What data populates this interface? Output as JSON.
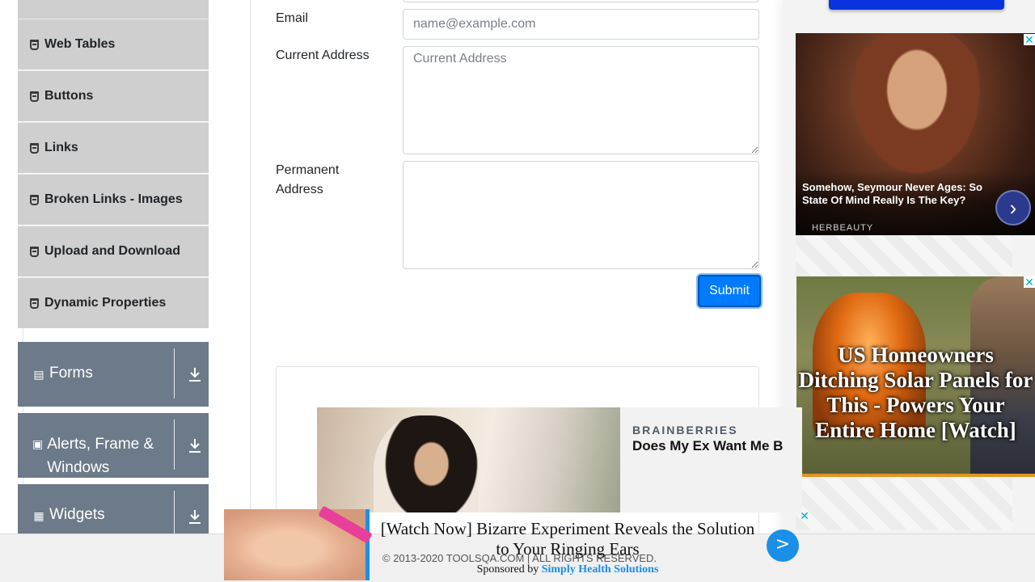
{
  "sidebar": {
    "elements_items": [
      {
        "label": ""
      },
      {
        "label": "Web Tables"
      },
      {
        "label": "Buttons"
      },
      {
        "label": "Links"
      },
      {
        "label": "Broken Links - Images"
      },
      {
        "label": "Upload and Download"
      },
      {
        "label": "Dynamic Properties"
      }
    ],
    "groups": [
      {
        "label": "Forms",
        "icon": "document-icon"
      },
      {
        "label": "Alerts, Frame & Windows",
        "icon": "window-icon"
      },
      {
        "label": "Widgets",
        "icon": "widgets-icon"
      }
    ]
  },
  "form": {
    "email_label": "Email",
    "email_placeholder": "name@example.com",
    "current_address_label": "Current Address",
    "current_address_placeholder": "Current Address",
    "permanent_address_label": "Permanent Address",
    "submit_label": "Submit"
  },
  "ads": {
    "right_top": {
      "headline": "Somehow, Seymour Never Ages: So State Of Mind Really Is The Key?",
      "brand": "HERBEAUTY",
      "close": "✕"
    },
    "right_bottom": {
      "headline": "US Homeowners Ditching Solar Panels for This - Powers Your Entire Home [Watch]",
      "close": "✕"
    },
    "brainberries": {
      "source": "BRAINBERRIES",
      "title": "Does My Ex Want Me B"
    },
    "sticky": {
      "headline": "[Watch Now] Bizarre Experiment Reveals the Solution to Your Ringing Ears",
      "sponsored_prefix": "Sponsored by",
      "sponsor": "Simply Health Solutions",
      "go": ">"
    },
    "close_x": "✕"
  },
  "footer": {
    "copyright": "© 2013-2020 TOOLSQA.COM | ALL RIGHTS RESERVED."
  },
  "colors": {
    "accent": "#007bff",
    "sidebar_group_bg": "#6c7a89",
    "menu_item_bg": "#cfcfcf"
  }
}
